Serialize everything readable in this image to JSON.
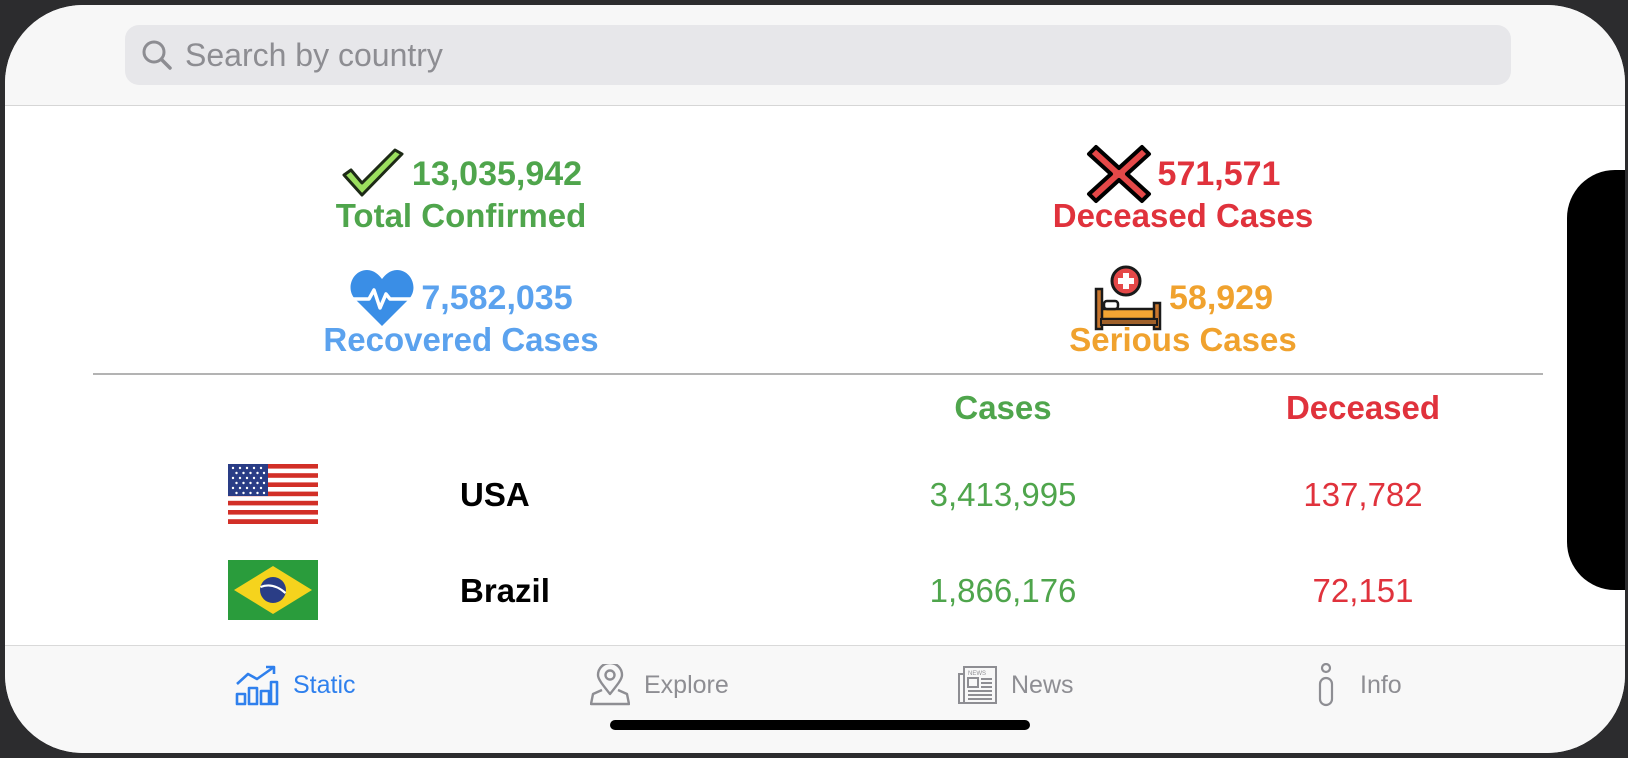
{
  "search": {
    "placeholder": "Search by country"
  },
  "stats": {
    "confirmed": {
      "value": "13,035,942",
      "label": "Total Confirmed"
    },
    "deceased": {
      "value": "571,571",
      "label": "Deceased Cases"
    },
    "recovered": {
      "value": "7,582,035",
      "label": "Recovered Cases"
    },
    "serious": {
      "value": "58,929",
      "label": "Serious Cases"
    }
  },
  "table": {
    "headers": {
      "cases": "Cases",
      "deceased": "Deceased"
    },
    "rows": [
      {
        "country": "USA",
        "cases": "3,413,995",
        "deceased": "137,782",
        "flag": "usa-flag"
      },
      {
        "country": "Brazil",
        "cases": "1,866,176",
        "deceased": "72,151",
        "flag": "brazil-flag"
      }
    ]
  },
  "tabs": [
    {
      "label": "Static",
      "icon": "chart-icon",
      "active": true
    },
    {
      "label": "Explore",
      "icon": "map-pin-icon",
      "active": false
    },
    {
      "label": "News",
      "icon": "newspaper-icon",
      "active": false
    },
    {
      "label": "Info",
      "icon": "info-icon",
      "active": false
    }
  ],
  "colors": {
    "confirmed": "#4fa54c",
    "deceased": "#e0323c",
    "recovered": "#5ba2ee",
    "serious": "#f0a22e",
    "tab_active": "#2f80ed",
    "tab_inactive": "#8e8e93"
  }
}
